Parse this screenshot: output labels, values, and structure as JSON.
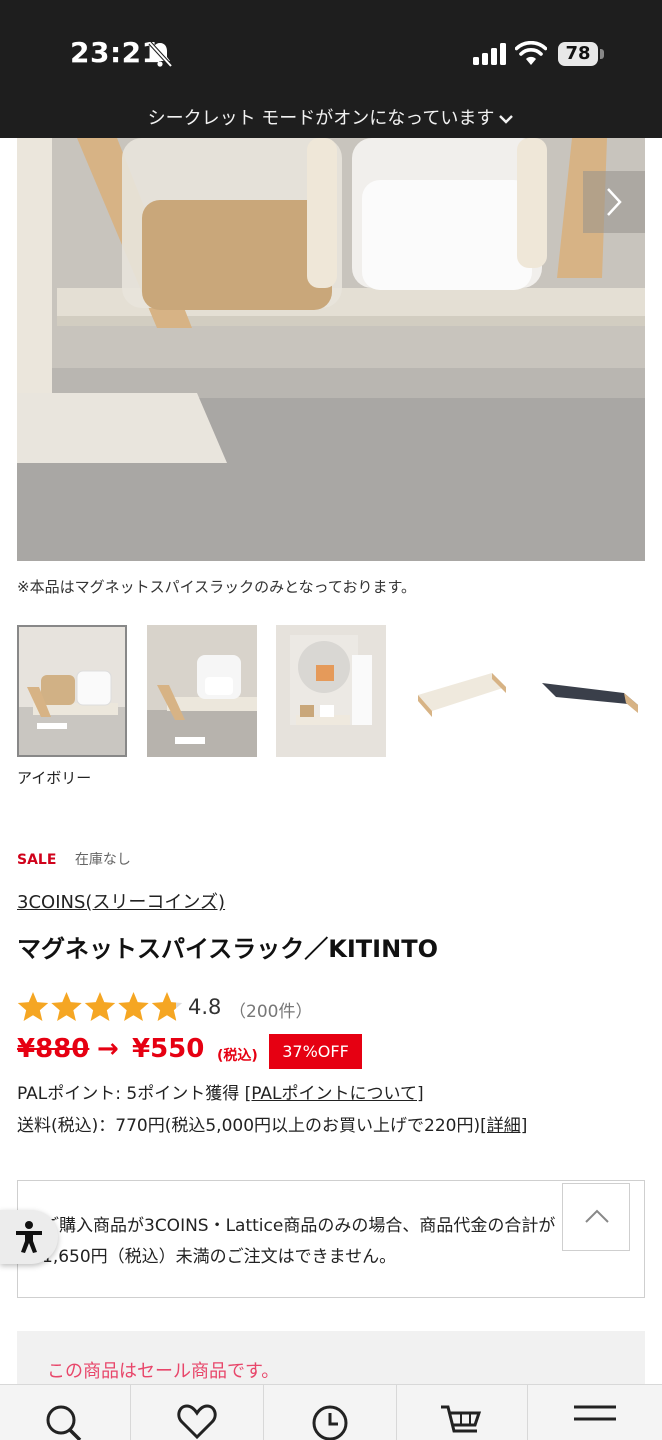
{
  "status_bar": {
    "time": "23:21",
    "battery": "78",
    "icons": [
      "bell-slash-icon",
      "signal-icon",
      "wifi-icon",
      "battery-icon"
    ]
  },
  "browser": {
    "incognito_banner": "シークレット モードがオンになっています"
  },
  "product": {
    "image_caption": "※本品はマグネットスパイスラックのみとなっております。",
    "selected_color": "アイボリー",
    "badges": {
      "sale": "SALE",
      "stock": "在庫なし"
    },
    "brand": "3COINS(スリーコインズ)",
    "name": "マグネットスパイスラック／KITINTO",
    "rating": {
      "value": "4.8",
      "count": "（200件）",
      "stars": 4.8
    },
    "price": {
      "original": "¥880",
      "arrow": "→",
      "sale": "¥550",
      "tax": "(税込)",
      "discount": "37%OFF"
    },
    "points": {
      "prefix": "PALポイント: 5ポイント獲得 ",
      "link": "[PALポイントについて]"
    },
    "shipping": {
      "prefix": "送料(税込)：770円(税込5,000円以上のお買い上げで220円)",
      "link": "[詳細]"
    }
  },
  "notice": {
    "text": "ご購入商品が3COINS・Lattice商品のみの場合、商品代金の合計が1,650円（税込）未満のご注文はできません。"
  },
  "sale_notice": "この商品はセール商品です。",
  "bottom_nav": [
    "search-icon",
    "heart-icon",
    "clock-icon",
    "cart-icon",
    "menu-icon"
  ],
  "colors": {
    "accent_red": "#e60012",
    "sale_pink": "#e8466a",
    "statusbar": "#1e1e1e"
  }
}
